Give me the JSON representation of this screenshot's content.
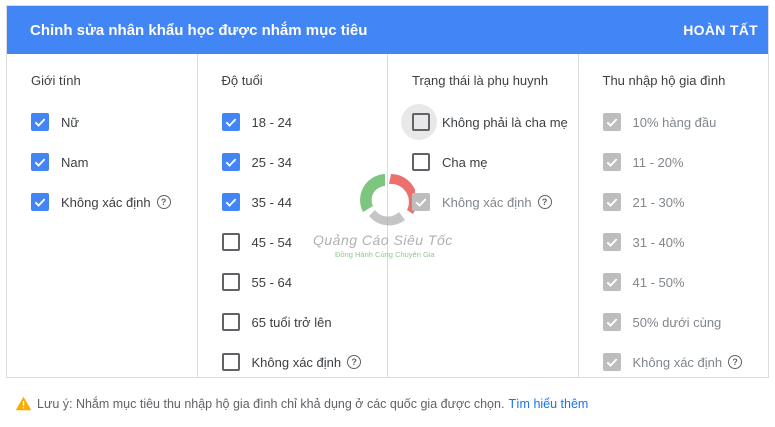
{
  "header": {
    "title": "Chỉnh sửa nhân khẩu học được nhắm mục tiêu",
    "done_label": "HOÀN TẤT"
  },
  "columns": [
    {
      "title": "Giới tính",
      "items": [
        {
          "label": "Nữ",
          "state": "checked"
        },
        {
          "label": "Nam",
          "state": "checked"
        },
        {
          "label": "Không xác định",
          "state": "checked",
          "help": true
        }
      ]
    },
    {
      "title": "Độ tuổi",
      "items": [
        {
          "label": "18 - 24",
          "state": "checked"
        },
        {
          "label": "25 - 34",
          "state": "checked"
        },
        {
          "label": "35 - 44",
          "state": "checked"
        },
        {
          "label": "45 - 54",
          "state": "unchecked"
        },
        {
          "label": "55 - 64",
          "state": "unchecked"
        },
        {
          "label": "65 tuổi trở lên",
          "state": "unchecked"
        },
        {
          "label": "Không xác định",
          "state": "unchecked",
          "help": true
        }
      ]
    },
    {
      "title": "Trạng thái là phụ huynh",
      "items": [
        {
          "label": "Không phải là cha mẹ",
          "state": "unchecked",
          "hover": true
        },
        {
          "label": "Cha mẹ",
          "state": "unchecked"
        },
        {
          "label": "Không xác định",
          "state": "disabled",
          "help": true
        }
      ]
    },
    {
      "title": "Thu nhập hộ gia đình",
      "items": [
        {
          "label": "10% hàng đầu",
          "state": "disabled"
        },
        {
          "label": "11 - 20%",
          "state": "disabled"
        },
        {
          "label": "21 - 30%",
          "state": "disabled"
        },
        {
          "label": "31 - 40%",
          "state": "disabled"
        },
        {
          "label": "41 - 50%",
          "state": "disabled"
        },
        {
          "label": "50% dưới cùng",
          "state": "disabled"
        },
        {
          "label": "Không xác định",
          "state": "disabled",
          "help": true
        }
      ]
    }
  ],
  "help_glyph": "?",
  "footer": {
    "note": "Lưu ý: Nhắm mục tiêu thu nhập hộ gia đình chỉ khả dụng ở các quốc gia được chọn.",
    "link": "Tìm hiểu thêm"
  },
  "watermark": {
    "text": "Quảng Cáo Siêu Tốc",
    "subtext": "Đồng Hành Cùng Chuyên Gia"
  },
  "colors": {
    "accent": "#4285f4",
    "disabled": "#bdbdbd",
    "link": "#1a73e8",
    "warning": "#f9ab00"
  }
}
